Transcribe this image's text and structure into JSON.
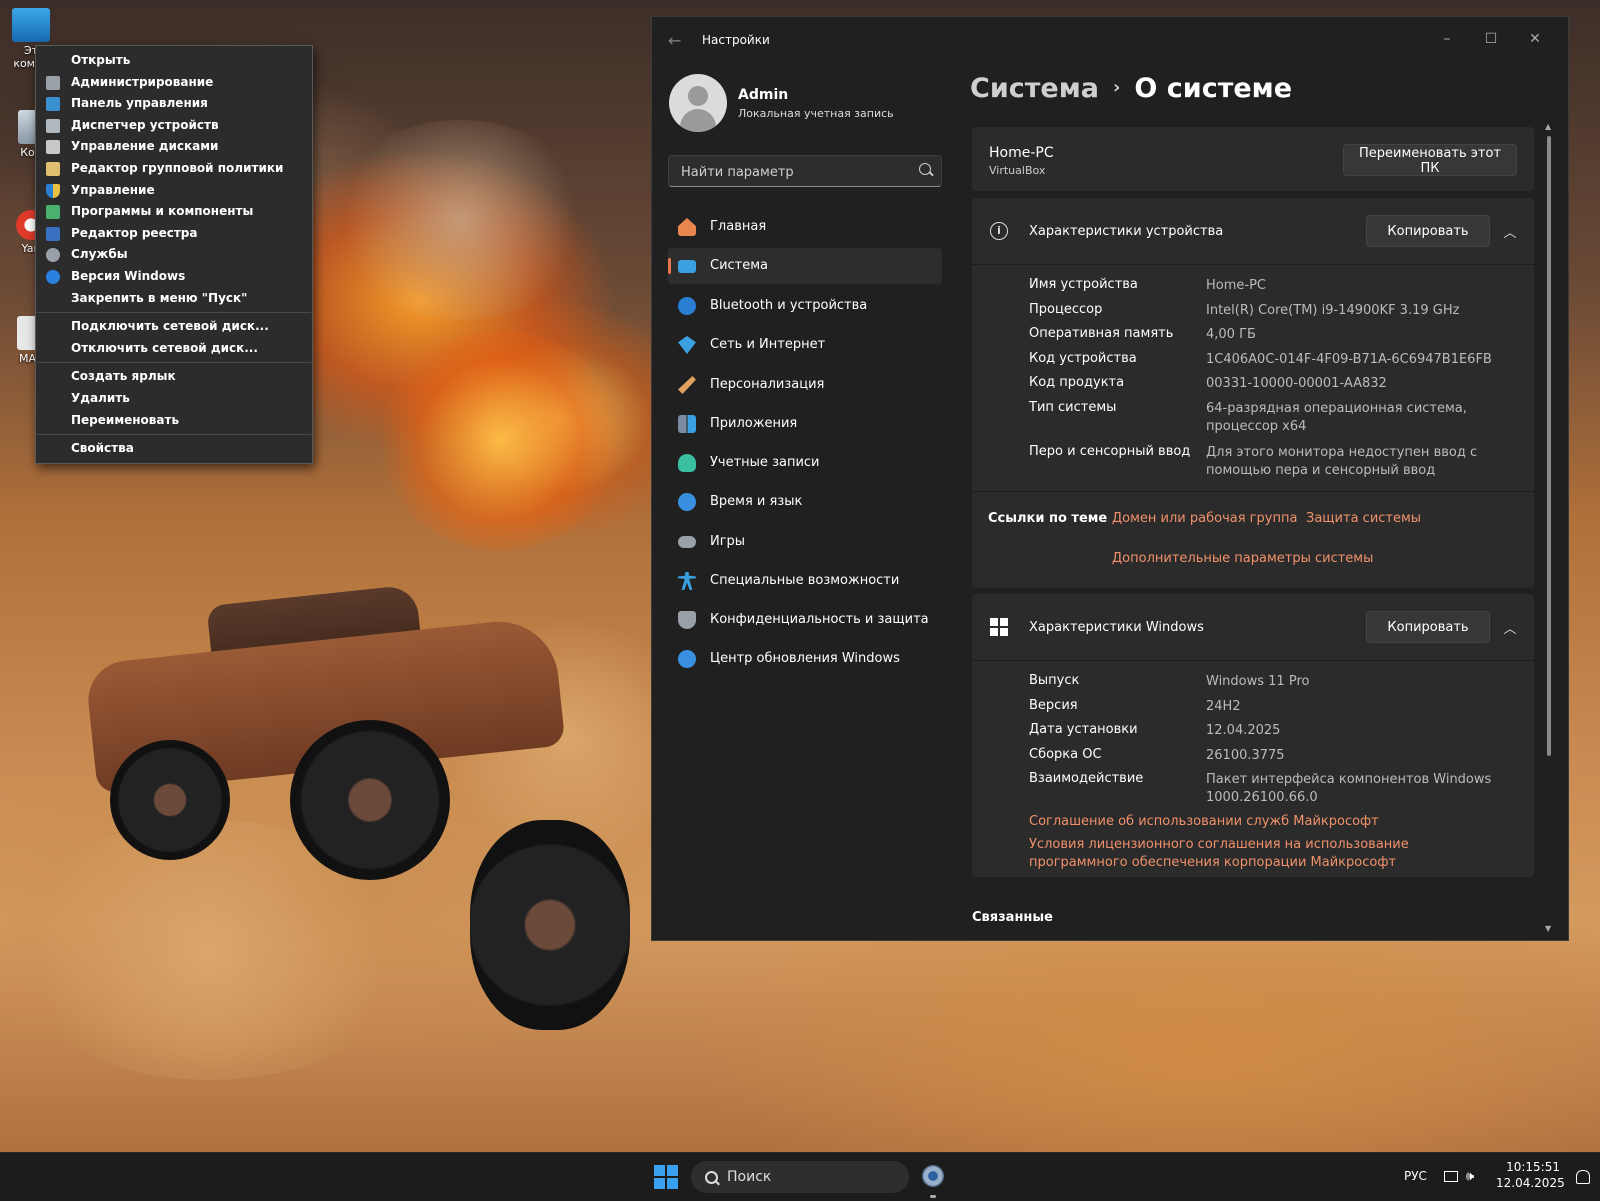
{
  "desktop": {
    "icons": [
      {
        "label": "Эт компь",
        "icon": "computer-icon"
      },
      {
        "label": "Кор",
        "icon": "recycle-bin-icon"
      },
      {
        "label": "Yan",
        "icon": "yandex-browser-icon"
      },
      {
        "label": "MAS",
        "icon": "mas-app-icon"
      }
    ]
  },
  "context_menu": {
    "groups": [
      [
        {
          "label": "Открыть",
          "icon": "none"
        },
        {
          "label": "Администрирование",
          "icon": "admin-tools-icon"
        },
        {
          "label": "Панель управления",
          "icon": "control-panel-icon"
        },
        {
          "label": "Диспетчер устройств",
          "icon": "device-manager-icon"
        },
        {
          "label": "Управление дисками",
          "icon": "disk-management-icon"
        },
        {
          "label": "Редактор групповой политики",
          "icon": "group-policy-icon"
        },
        {
          "label": "Управление",
          "icon": "shield-icon"
        },
        {
          "label": "Программы и компоненты",
          "icon": "programs-icon"
        },
        {
          "label": "Редактор реестра",
          "icon": "registry-icon"
        },
        {
          "label": "Службы",
          "icon": "services-gear-icon"
        },
        {
          "label": "Версия Windows",
          "icon": "info-icon"
        },
        {
          "label": "Закрепить в меню \"Пуск\"",
          "icon": "none"
        }
      ],
      [
        {
          "label": "Подключить сетевой диск...",
          "icon": "none"
        },
        {
          "label": "Отключить сетевой диск...",
          "icon": "none"
        }
      ],
      [
        {
          "label": "Создать ярлык",
          "icon": "none"
        },
        {
          "label": "Удалить",
          "icon": "none"
        },
        {
          "label": "Переименовать",
          "icon": "none"
        }
      ],
      [
        {
          "label": "Свойства",
          "icon": "none"
        }
      ]
    ]
  },
  "settings": {
    "title": "Настройки",
    "user": {
      "name": "Admin",
      "account_type": "Локальная учетная запись"
    },
    "search_placeholder": "Найти параметр",
    "nav": [
      {
        "label": "Главная",
        "icon": "home-icon",
        "color": "#e8864e",
        "active": false
      },
      {
        "label": "Система",
        "icon": "system-display-icon",
        "color": "#3aa0e0",
        "active": true
      },
      {
        "label": "Bluetooth и устройства",
        "icon": "bluetooth-icon",
        "color": "#2a7fd4",
        "active": false
      },
      {
        "label": "Сеть и Интернет",
        "icon": "wifi-icon",
        "color": "#3aa0e0",
        "active": false
      },
      {
        "label": "Персонализация",
        "icon": "brush-icon",
        "color": "#e0a060",
        "active": false
      },
      {
        "label": "Приложения",
        "icon": "apps-icon",
        "color": "#7a8aa0",
        "active": false
      },
      {
        "label": "Учетные записи",
        "icon": "accounts-icon",
        "color": "#3ac0a0",
        "active": false
      },
      {
        "label": "Время и язык",
        "icon": "time-language-icon",
        "color": "#3a90e0",
        "active": false
      },
      {
        "label": "Игры",
        "icon": "gamepad-icon",
        "color": "#9aa0a8",
        "active": false
      },
      {
        "label": "Специальные возможности",
        "icon": "accessibility-icon",
        "color": "#3aa0e0",
        "active": false
      },
      {
        "label": "Конфиденциальность и защита",
        "icon": "privacy-shield-icon",
        "color": "#9aa0a8",
        "active": false
      },
      {
        "label": "Центр обновления Windows",
        "icon": "windows-update-icon",
        "color": "#3a90e0",
        "active": false
      }
    ],
    "breadcrumb": {
      "parent": "Система",
      "separator": "›",
      "current": "О системе"
    },
    "pc": {
      "name": "Home-PC",
      "model": "VirtualBox",
      "rename_button": "Переименовать этот ПК"
    },
    "device_specs": {
      "title": "Характеристики устройства",
      "copy_button": "Копировать",
      "rows": [
        {
          "key": "Имя устройства",
          "value": "Home-PC"
        },
        {
          "key": "Процессор",
          "value": "Intel(R) Core(TM) i9-14900KF   3.19 GHz"
        },
        {
          "key": "Оперативная память",
          "value": "4,00 ГБ"
        },
        {
          "key": "Код устройства",
          "value": "1C406A0C-014F-4F09-B71A-6C6947B1E6FB"
        },
        {
          "key": "Код продукта",
          "value": "00331-10000-00001-AA832"
        },
        {
          "key": "Тип системы",
          "value": "64-разрядная операционная система, процессор x64"
        },
        {
          "key": "Перо и сенсорный ввод",
          "value": "Для этого монитора недоступен ввод с помощью пера и сенсорный ввод"
        }
      ],
      "related_links_label": "Ссылки по теме",
      "related_links": [
        "Домен или рабочая группа",
        "Защита системы",
        "Дополнительные параметры системы"
      ]
    },
    "windows_specs": {
      "title": "Характеристики Windows",
      "copy_button": "Копировать",
      "rows": [
        {
          "key": "Выпуск",
          "value": "Windows 11 Pro"
        },
        {
          "key": "Версия",
          "value": "24H2"
        },
        {
          "key": "Дата установки",
          "value": "12.04.2025"
        },
        {
          "key": "Сборка ОС",
          "value": "26100.3775"
        },
        {
          "key": "Взаимодействие",
          "value": "Пакет интерфейса компонентов Windows 1000.26100.66.0"
        }
      ],
      "links": [
        "Соглашение об использовании служб Майкрософт",
        "Условия лицензионного соглашения на использование программного обеспечения корпорации Майкрософт"
      ]
    },
    "related_section": "Связанные"
  },
  "taskbar": {
    "search_label": "Поиск",
    "language": "РУС",
    "time": "10:15:51",
    "date": "12.04.2025"
  },
  "colors": {
    "accent": "#e8744e",
    "link": "#f0916b",
    "window_bg": "#202020",
    "card_bg": "#2b2b2b"
  }
}
